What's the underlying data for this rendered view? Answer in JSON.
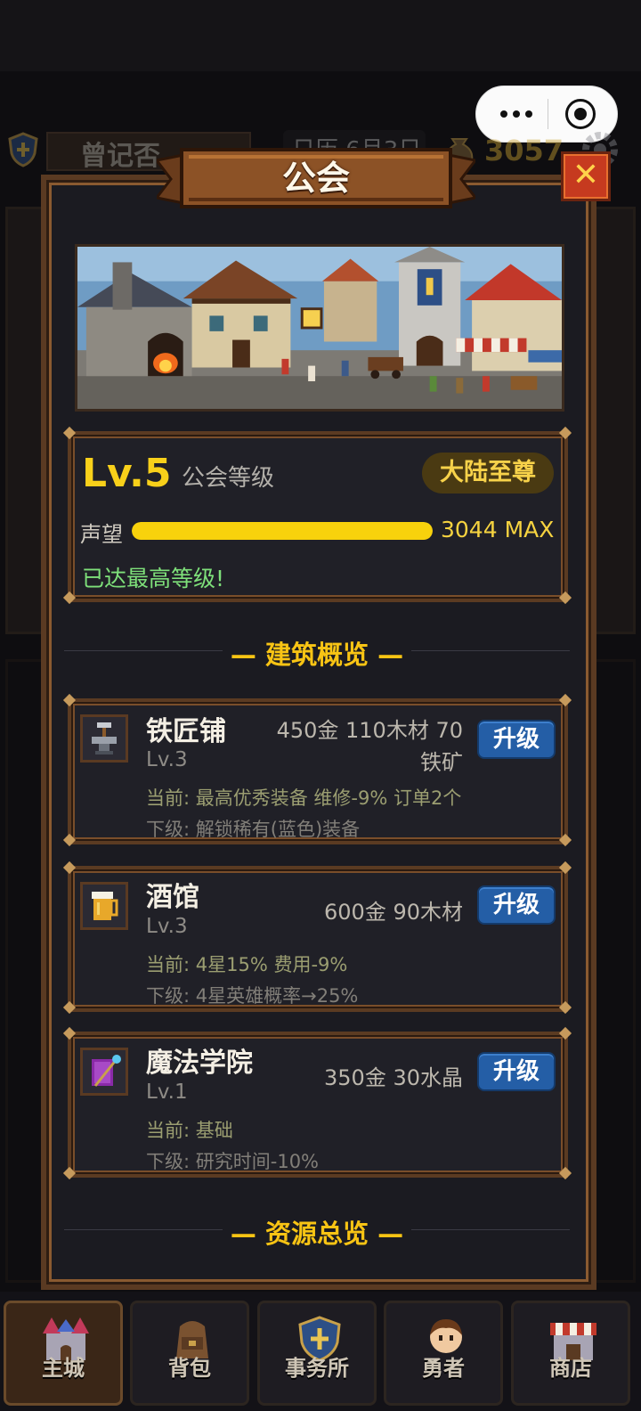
{
  "header": {
    "player_name": "曾记否",
    "date": "日历 6月3日",
    "gold": "3057"
  },
  "modal": {
    "title": "公会",
    "close_label": "✕"
  },
  "guild": {
    "level_value": "Lv.5",
    "level_label": "公会等级",
    "rank_badge": "大陆至尊",
    "reputation_label": "声望",
    "reputation_fraction": 1.0,
    "reputation_value": "3044 MAX",
    "max_status": "已达最高等级!"
  },
  "sections": {
    "buildings_title": "— 建筑概览 —",
    "resources_title": "— 资源总览 —"
  },
  "buildings": [
    {
      "icon": "anvil-icon",
      "name": "铁匠铺",
      "level": "Lv.3",
      "cost_line1": "450金 110木材 70",
      "cost_line2": "铁矿",
      "upgrade_label": "升级",
      "current": "当前: 最高优秀装备 维修-9% 订单2个",
      "next": "下级: 解锁稀有(蓝色)装备"
    },
    {
      "icon": "beer-mug-icon",
      "name": "酒馆",
      "level": "Lv.3",
      "cost_line1": "600金 90木材",
      "upgrade_label": "升级",
      "current": "当前: 4星15% 费用-9%",
      "next": "下级: 4星英雄概率→25%"
    },
    {
      "icon": "magic-staff-icon",
      "name": "魔法学院",
      "level": "Lv.1",
      "cost_line1": "350金 30水晶",
      "upgrade_label": "升级",
      "current": "当前: 基础",
      "next": "下级: 研究时间-10%"
    }
  ],
  "nav": [
    {
      "label": "主城",
      "icon": "castle-icon",
      "active": true
    },
    {
      "label": "背包",
      "icon": "backpack-icon",
      "active": false
    },
    {
      "label": "事务所",
      "icon": "shield-icon",
      "active": false
    },
    {
      "label": "勇者",
      "icon": "hero-icon",
      "active": false
    },
    {
      "label": "商店",
      "icon": "shop-icon",
      "active": false
    }
  ],
  "colors": {
    "accent_gold": "#f8d01a",
    "success_green": "#7ee07a",
    "upgrade_blue": "#245ea6",
    "frame_brown": "#5a3a22"
  }
}
